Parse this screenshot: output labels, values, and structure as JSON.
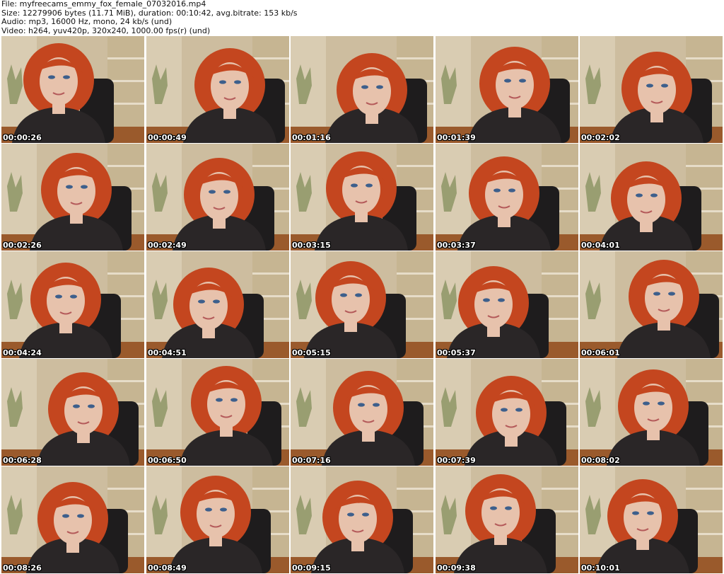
{
  "header": {
    "file_line": "File: myfreecams_emmy_fox_female_07032016.mp4",
    "size_line": "Size: 12279906 bytes (11.71 MiB), duration: 00:10:42, avg.bitrate: 153 kb/s",
    "audio_line": "Audio: mp3, 16000 Hz, mono, 24 kb/s (und)",
    "video_line": "Video: h264, yuv420p, 320x240, 1000.00 fps(r) (und)"
  },
  "thumbnails": [
    {
      "timestamp": "00:00:26"
    },
    {
      "timestamp": "00:00:49"
    },
    {
      "timestamp": "00:01:16"
    },
    {
      "timestamp": "00:01:39"
    },
    {
      "timestamp": "00:02:02"
    },
    {
      "timestamp": "00:02:26"
    },
    {
      "timestamp": "00:02:49"
    },
    {
      "timestamp": "00:03:15"
    },
    {
      "timestamp": "00:03:37"
    },
    {
      "timestamp": "00:04:01"
    },
    {
      "timestamp": "00:04:24"
    },
    {
      "timestamp": "00:04:51"
    },
    {
      "timestamp": "00:05:15"
    },
    {
      "timestamp": "00:05:37"
    },
    {
      "timestamp": "00:06:01"
    },
    {
      "timestamp": "00:06:28"
    },
    {
      "timestamp": "00:06:50"
    },
    {
      "timestamp": "00:07:16"
    },
    {
      "timestamp": "00:07:39"
    },
    {
      "timestamp": "00:08:02"
    },
    {
      "timestamp": "00:08:26"
    },
    {
      "timestamp": "00:08:49"
    },
    {
      "timestamp": "00:09:15"
    },
    {
      "timestamp": "00:09:38"
    },
    {
      "timestamp": "00:10:01"
    }
  ],
  "colors": {
    "background": "#ffffff",
    "wall": "#cdbd9f",
    "hair": "#c4461f",
    "skin": "#e7c2ac",
    "shirt": "#2a2627",
    "chair": "#1e1c1d",
    "floor": "#9a5a2c"
  }
}
